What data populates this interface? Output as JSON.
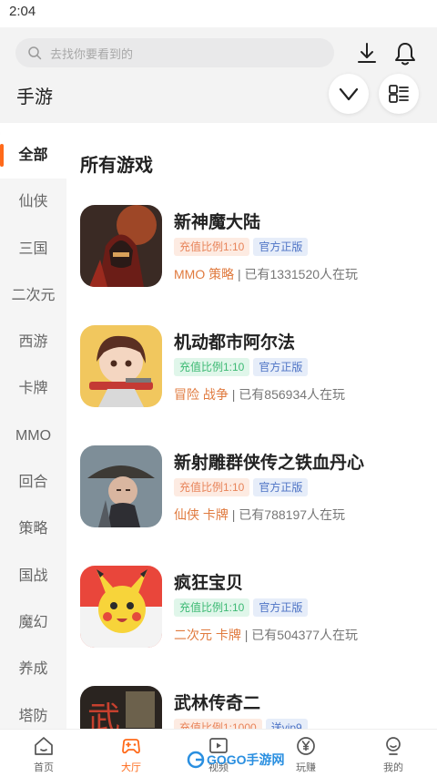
{
  "status": {
    "time": "2:04"
  },
  "search": {
    "placeholder": "去找你要看到的"
  },
  "header": {
    "title": "手游"
  },
  "sidebar": {
    "items": [
      {
        "label": "全部",
        "active": true
      },
      {
        "label": "仙侠"
      },
      {
        "label": "三国"
      },
      {
        "label": "二次元"
      },
      {
        "label": "西游"
      },
      {
        "label": "卡牌"
      },
      {
        "label": "MMO"
      },
      {
        "label": "回合"
      },
      {
        "label": "策略"
      },
      {
        "label": "国战"
      },
      {
        "label": "魔幻"
      },
      {
        "label": "养成"
      },
      {
        "label": "塔防"
      }
    ]
  },
  "main": {
    "section_title": "所有游戏"
  },
  "games": [
    {
      "name": "新神魔大陆",
      "tag1": "充值比例1:10",
      "tag1_color": "orange",
      "tag2": "官方正版",
      "categories": "MMO 策略",
      "players": "| 已有1331520人在玩",
      "icon": "warrior-icon"
    },
    {
      "name": "机动都市阿尔法",
      "tag1": "充值比例1:10",
      "tag1_color": "green",
      "tag2": "官方正版",
      "categories": "冒险 战争",
      "players": "| 已有856934人在玩",
      "icon": "gunner-girl-icon"
    },
    {
      "name": "新射雕群侠传之铁血丹心",
      "tag1": "充值比例1:10",
      "tag1_color": "orange",
      "tag2": "官方正版",
      "categories": "仙侠 卡牌",
      "players": "| 已有788197人在玩",
      "icon": "swordsman-icon"
    },
    {
      "name": "疯狂宝贝",
      "tag1": "充值比例1:10",
      "tag1_color": "green",
      "tag2": "官方正版",
      "categories": "二次元 卡牌",
      "players": "| 已有504377人在玩",
      "icon": "pikachu-icon"
    },
    {
      "name": "武林传奇二",
      "tag1": "充值比例1:1000",
      "tag1_color": "orange",
      "tag2": "送vip9",
      "categories": "",
      "players": "",
      "icon": "wulin-icon"
    }
  ],
  "bottom_nav": [
    {
      "label": "首页",
      "icon": "home-icon"
    },
    {
      "label": "大厅",
      "icon": "gamepad-icon",
      "active": true
    },
    {
      "label": "视频",
      "icon": "video-icon"
    },
    {
      "label": "玩赚",
      "icon": "yuan-icon"
    },
    {
      "label": "我的",
      "icon": "profile-icon"
    }
  ],
  "watermark": {
    "text": "GOGO手游网"
  },
  "colors": {
    "accent": "#ff6a1a",
    "tag_orange": "#e8845a",
    "tag_green": "#3dba74",
    "tag_blue": "#4d73c5"
  }
}
